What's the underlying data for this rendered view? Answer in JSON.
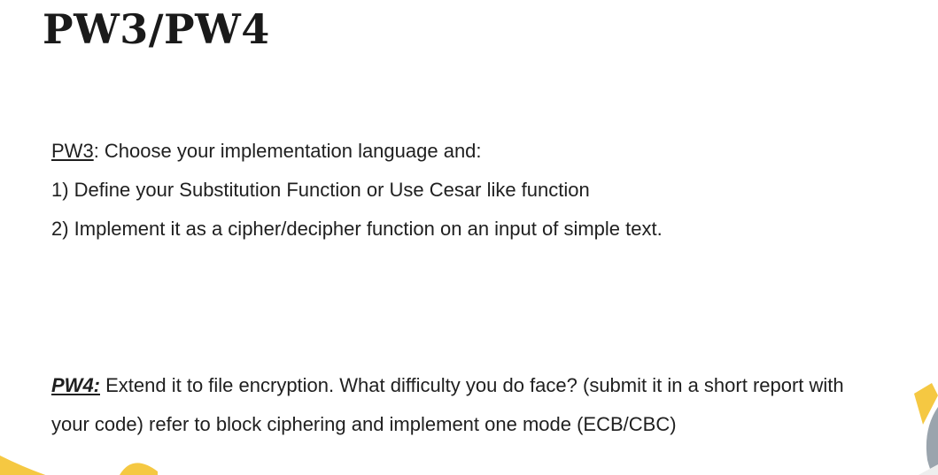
{
  "slide": {
    "title": "PW3/PW4",
    "pw3": {
      "tag": "PW3",
      "intro": ": Choose your implementation language and:",
      "step1": "1) Define your Substitution Function or Use Cesar like function",
      "step2": "2) Implement it as a cipher/decipher function on an input of simple text."
    },
    "pw4": {
      "tag": "PW4:",
      "line1": " Extend it to file encryption. What difficulty you do face? (submit it in a short report with",
      "line2": "your code)  refer to block ciphering and implement one mode (ECB/CBC)"
    }
  },
  "decorations": {
    "accent_yellow": "#f5c842",
    "accent_gray": "#9aa4ad"
  }
}
